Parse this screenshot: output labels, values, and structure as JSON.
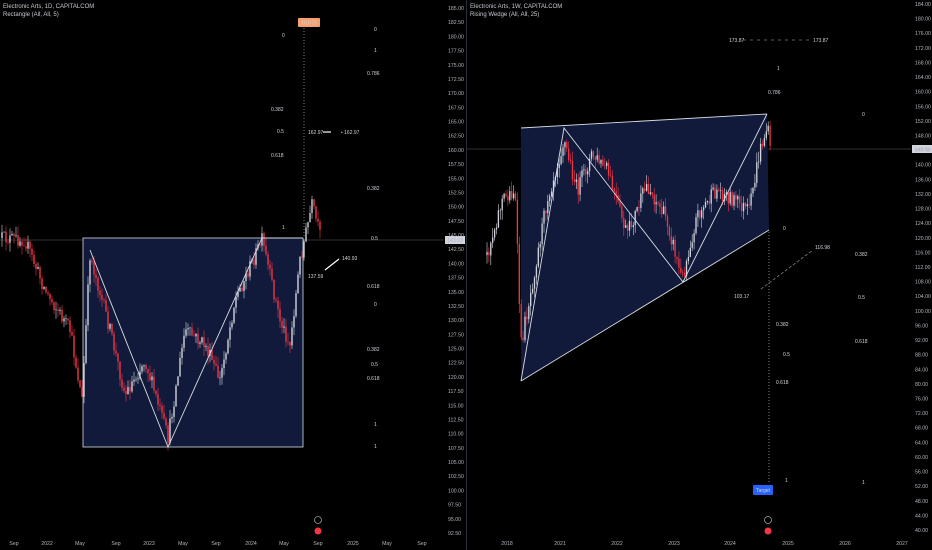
{
  "panels": [
    {
      "id": "left",
      "header": {
        "symbol": "Electronic Arts, 1D, CAPITALCOM",
        "indicator": "Rectangle (All, All, 5)"
      },
      "price_badge": "143.93",
      "tag_badge": "10,073",
      "fib_labels": [
        "0",
        "1",
        "0.786",
        "0.382",
        "0.5",
        "0.618",
        "0.382",
        "1",
        "0.5",
        "0.618",
        "0",
        "0.382",
        "0.5",
        "0.618",
        "1",
        "1"
      ],
      "annotations": [
        "162.97",
        "162.97",
        "140.93",
        "137.59"
      ],
      "chart_data": {
        "type": "candlestick",
        "y_axis": {
          "min": 92.5,
          "max": 185.0,
          "ticks": [
            "185.00",
            "182.50",
            "180.00",
            "177.50",
            "175.00",
            "172.50",
            "170.00",
            "167.50",
            "165.00",
            "162.50",
            "160.00",
            "157.50",
            "155.00",
            "152.50",
            "150.00",
            "147.50",
            "145.00",
            "142.50",
            "140.00",
            "137.50",
            "135.00",
            "132.50",
            "130.00",
            "127.50",
            "125.00",
            "122.50",
            "120.00",
            "117.50",
            "115.00",
            "112.50",
            "110.00",
            "107.50",
            "105.00",
            "102.50",
            "100.00",
            "97.50",
            "95.00",
            "92.50"
          ]
        },
        "x_axis": {
          "ticks": [
            "Sep",
            "2022",
            "May",
            "Sep",
            "2023",
            "May",
            "Sep",
            "2024",
            "May",
            "Sep",
            "2025",
            "May",
            "Sep"
          ]
        },
        "pattern": {
          "name": "Rectangle",
          "top": 143.9,
          "bottom": 108.6
        },
        "last_price": 143.93
      }
    },
    {
      "id": "right",
      "header": {
        "symbol": "Electronic Arts, 1W, CAPITALCOM",
        "indicator": "Rising Wedge (All, All, 25)"
      },
      "price_badge": "143.93",
      "target_label": "Target",
      "fib_labels": [
        "1",
        "0.786",
        "0",
        "0.382",
        "0.5",
        "0.618",
        "0",
        "0.382",
        "0.5",
        "0.618",
        "1",
        "1"
      ],
      "annotations": [
        "173.87",
        "173.87",
        "116.98",
        "103.17"
      ],
      "chart_data": {
        "type": "candlestick",
        "y_axis": {
          "min": 40.0,
          "max": 184.0,
          "ticks": [
            "184.00",
            "180.00",
            "176.00",
            "172.00",
            "168.00",
            "164.00",
            "160.00",
            "156.00",
            "152.00",
            "148.00",
            "144.00",
            "140.00",
            "136.00",
            "132.00",
            "128.00",
            "124.00",
            "120.00",
            "116.00",
            "112.00",
            "108.00",
            "104.00",
            "100.00",
            "96.00",
            "92.00",
            "88.00",
            "84.00",
            "80.00",
            "76.00",
            "72.00",
            "68.00",
            "64.00",
            "60.00",
            "56.00",
            "52.00",
            "48.00",
            "44.00",
            "40.00"
          ]
        },
        "x_axis": {
          "ticks": [
            "2018",
            "2021",
            "2022",
            "2023",
            "2024",
            "2025",
            "2026",
            "2027"
          ]
        },
        "pattern": {
          "name": "Rising Wedge"
        },
        "last_price": 143.93
      }
    }
  ],
  "colors": {
    "background": "#000000",
    "up": "#d1d4dc",
    "down": "#f23645",
    "pattern_fill": "#111a3a",
    "pattern_line": "#d9dbe3",
    "target_badge": "#2962ff",
    "tag_badge": "#f7a06e"
  }
}
